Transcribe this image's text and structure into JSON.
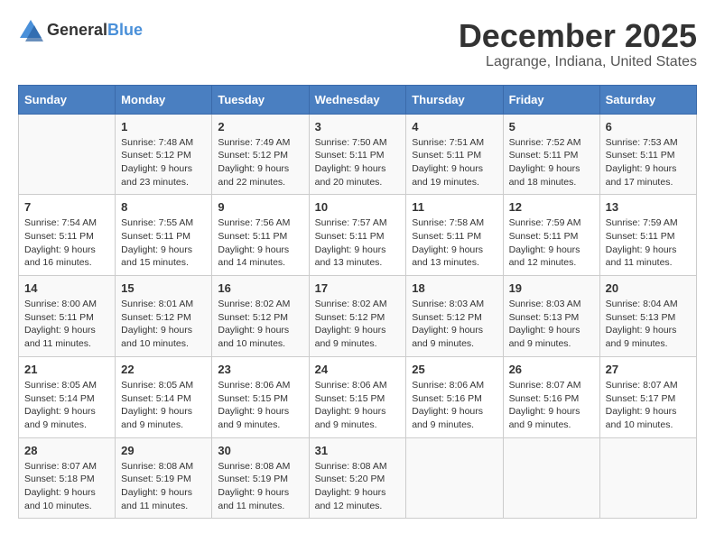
{
  "logo": {
    "general": "General",
    "blue": "Blue"
  },
  "title": "December 2025",
  "subtitle": "Lagrange, Indiana, United States",
  "columns": [
    "Sunday",
    "Monday",
    "Tuesday",
    "Wednesday",
    "Thursday",
    "Friday",
    "Saturday"
  ],
  "weeks": [
    [
      {
        "day": "",
        "sunrise": "",
        "sunset": "",
        "daylight": ""
      },
      {
        "day": "1",
        "sunrise": "Sunrise: 7:48 AM",
        "sunset": "Sunset: 5:12 PM",
        "daylight": "Daylight: 9 hours and 23 minutes."
      },
      {
        "day": "2",
        "sunrise": "Sunrise: 7:49 AM",
        "sunset": "Sunset: 5:12 PM",
        "daylight": "Daylight: 9 hours and 22 minutes."
      },
      {
        "day": "3",
        "sunrise": "Sunrise: 7:50 AM",
        "sunset": "Sunset: 5:11 PM",
        "daylight": "Daylight: 9 hours and 20 minutes."
      },
      {
        "day": "4",
        "sunrise": "Sunrise: 7:51 AM",
        "sunset": "Sunset: 5:11 PM",
        "daylight": "Daylight: 9 hours and 19 minutes."
      },
      {
        "day": "5",
        "sunrise": "Sunrise: 7:52 AM",
        "sunset": "Sunset: 5:11 PM",
        "daylight": "Daylight: 9 hours and 18 minutes."
      },
      {
        "day": "6",
        "sunrise": "Sunrise: 7:53 AM",
        "sunset": "Sunset: 5:11 PM",
        "daylight": "Daylight: 9 hours and 17 minutes."
      }
    ],
    [
      {
        "day": "7",
        "sunrise": "Sunrise: 7:54 AM",
        "sunset": "Sunset: 5:11 PM",
        "daylight": "Daylight: 9 hours and 16 minutes."
      },
      {
        "day": "8",
        "sunrise": "Sunrise: 7:55 AM",
        "sunset": "Sunset: 5:11 PM",
        "daylight": "Daylight: 9 hours and 15 minutes."
      },
      {
        "day": "9",
        "sunrise": "Sunrise: 7:56 AM",
        "sunset": "Sunset: 5:11 PM",
        "daylight": "Daylight: 9 hours and 14 minutes."
      },
      {
        "day": "10",
        "sunrise": "Sunrise: 7:57 AM",
        "sunset": "Sunset: 5:11 PM",
        "daylight": "Daylight: 9 hours and 13 minutes."
      },
      {
        "day": "11",
        "sunrise": "Sunrise: 7:58 AM",
        "sunset": "Sunset: 5:11 PM",
        "daylight": "Daylight: 9 hours and 13 minutes."
      },
      {
        "day": "12",
        "sunrise": "Sunrise: 7:59 AM",
        "sunset": "Sunset: 5:11 PM",
        "daylight": "Daylight: 9 hours and 12 minutes."
      },
      {
        "day": "13",
        "sunrise": "Sunrise: 7:59 AM",
        "sunset": "Sunset: 5:11 PM",
        "daylight": "Daylight: 9 hours and 11 minutes."
      }
    ],
    [
      {
        "day": "14",
        "sunrise": "Sunrise: 8:00 AM",
        "sunset": "Sunset: 5:11 PM",
        "daylight": "Daylight: 9 hours and 11 minutes."
      },
      {
        "day": "15",
        "sunrise": "Sunrise: 8:01 AM",
        "sunset": "Sunset: 5:12 PM",
        "daylight": "Daylight: 9 hours and 10 minutes."
      },
      {
        "day": "16",
        "sunrise": "Sunrise: 8:02 AM",
        "sunset": "Sunset: 5:12 PM",
        "daylight": "Daylight: 9 hours and 10 minutes."
      },
      {
        "day": "17",
        "sunrise": "Sunrise: 8:02 AM",
        "sunset": "Sunset: 5:12 PM",
        "daylight": "Daylight: 9 hours and 9 minutes."
      },
      {
        "day": "18",
        "sunrise": "Sunrise: 8:03 AM",
        "sunset": "Sunset: 5:12 PM",
        "daylight": "Daylight: 9 hours and 9 minutes."
      },
      {
        "day": "19",
        "sunrise": "Sunrise: 8:03 AM",
        "sunset": "Sunset: 5:13 PM",
        "daylight": "Daylight: 9 hours and 9 minutes."
      },
      {
        "day": "20",
        "sunrise": "Sunrise: 8:04 AM",
        "sunset": "Sunset: 5:13 PM",
        "daylight": "Daylight: 9 hours and 9 minutes."
      }
    ],
    [
      {
        "day": "21",
        "sunrise": "Sunrise: 8:05 AM",
        "sunset": "Sunset: 5:14 PM",
        "daylight": "Daylight: 9 hours and 9 minutes."
      },
      {
        "day": "22",
        "sunrise": "Sunrise: 8:05 AM",
        "sunset": "Sunset: 5:14 PM",
        "daylight": "Daylight: 9 hours and 9 minutes."
      },
      {
        "day": "23",
        "sunrise": "Sunrise: 8:06 AM",
        "sunset": "Sunset: 5:15 PM",
        "daylight": "Daylight: 9 hours and 9 minutes."
      },
      {
        "day": "24",
        "sunrise": "Sunrise: 8:06 AM",
        "sunset": "Sunset: 5:15 PM",
        "daylight": "Daylight: 9 hours and 9 minutes."
      },
      {
        "day": "25",
        "sunrise": "Sunrise: 8:06 AM",
        "sunset": "Sunset: 5:16 PM",
        "daylight": "Daylight: 9 hours and 9 minutes."
      },
      {
        "day": "26",
        "sunrise": "Sunrise: 8:07 AM",
        "sunset": "Sunset: 5:16 PM",
        "daylight": "Daylight: 9 hours and 9 minutes."
      },
      {
        "day": "27",
        "sunrise": "Sunrise: 8:07 AM",
        "sunset": "Sunset: 5:17 PM",
        "daylight": "Daylight: 9 hours and 10 minutes."
      }
    ],
    [
      {
        "day": "28",
        "sunrise": "Sunrise: 8:07 AM",
        "sunset": "Sunset: 5:18 PM",
        "daylight": "Daylight: 9 hours and 10 minutes."
      },
      {
        "day": "29",
        "sunrise": "Sunrise: 8:08 AM",
        "sunset": "Sunset: 5:19 PM",
        "daylight": "Daylight: 9 hours and 11 minutes."
      },
      {
        "day": "30",
        "sunrise": "Sunrise: 8:08 AM",
        "sunset": "Sunset: 5:19 PM",
        "daylight": "Daylight: 9 hours and 11 minutes."
      },
      {
        "day": "31",
        "sunrise": "Sunrise: 8:08 AM",
        "sunset": "Sunset: 5:20 PM",
        "daylight": "Daylight: 9 hours and 12 minutes."
      },
      {
        "day": "",
        "sunrise": "",
        "sunset": "",
        "daylight": ""
      },
      {
        "day": "",
        "sunrise": "",
        "sunset": "",
        "daylight": ""
      },
      {
        "day": "",
        "sunrise": "",
        "sunset": "",
        "daylight": ""
      }
    ]
  ]
}
